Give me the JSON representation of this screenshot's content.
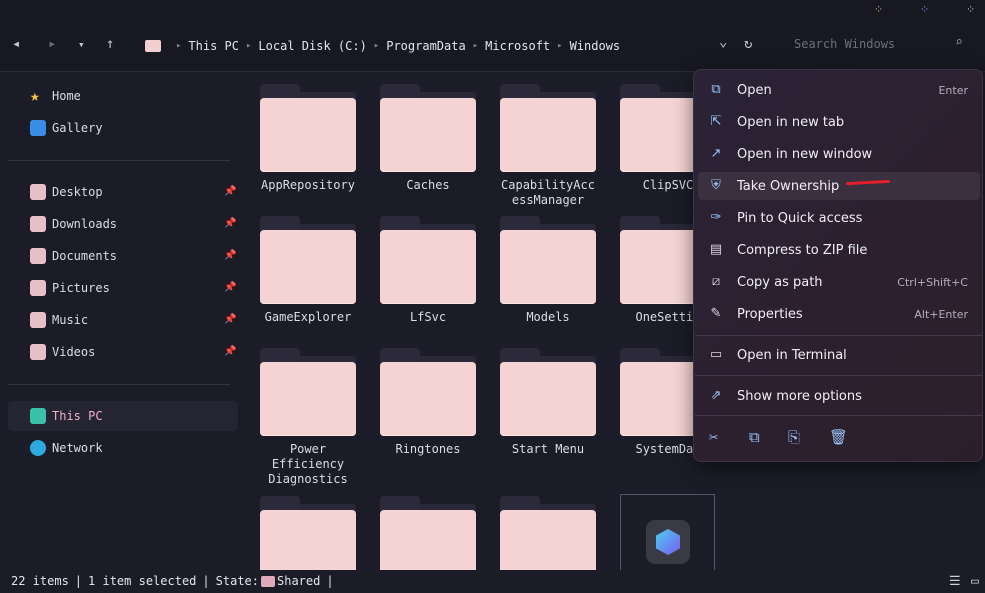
{
  "nav": {
    "back_icon": "◂",
    "forward_icon": "▸",
    "history_icon": "▾",
    "up_icon": "↑",
    "refresh_icon": "↻",
    "dropdown_icon": "⌄",
    "breadcrumb": [
      "This PC",
      "Local Disk (C:)",
      "ProgramData",
      "Microsoft",
      "Windows"
    ],
    "search_placeholder": "Search Windows"
  },
  "sidebar": {
    "quick": [
      {
        "label": "Home",
        "icon": "star-icon",
        "color": "#f5c242"
      },
      {
        "label": "Gallery",
        "icon": "gallery-icon",
        "color": "#3a8ee6"
      }
    ],
    "pinned": [
      {
        "label": "Desktop",
        "icon": "desktop-icon"
      },
      {
        "label": "Downloads",
        "icon": "downloads-icon"
      },
      {
        "label": "Documents",
        "icon": "documents-icon"
      },
      {
        "label": "Pictures",
        "icon": "pictures-icon"
      },
      {
        "label": "Music",
        "icon": "music-icon"
      },
      {
        "label": "Videos",
        "icon": "videos-icon"
      }
    ],
    "devices": [
      {
        "label": "This PC",
        "icon": "pc-icon",
        "color": "#3ac0a8"
      },
      {
        "label": "Network",
        "icon": "network-icon",
        "color": "#2ea8e0"
      }
    ]
  },
  "folders": [
    "AppRepository",
    "Caches",
    "CapabilityAccessManager",
    "ClipSVC",
    "GameExplorer",
    "LfSvc",
    "Models",
    "OneSettin",
    "Power Efficiency Diagnostics",
    "Ringtones",
    "Start Menu",
    "SystemDat",
    "",
    "",
    ""
  ],
  "folder_labels_wrapped": {
    "capability_1": "CapabilityAcc",
    "capability_2": "essManager",
    "power_1": "Power",
    "power_2": "Efficiency",
    "power_3": "Diagnostics"
  },
  "context_menu": {
    "items": [
      {
        "label": "Open",
        "shortcut": "Enter",
        "icon": "open-icon"
      },
      {
        "label": "Open in new tab",
        "shortcut": "",
        "icon": "new-tab-icon"
      },
      {
        "label": "Open in new window",
        "shortcut": "",
        "icon": "new-window-icon"
      },
      {
        "label": "Take Ownership",
        "shortcut": "",
        "icon": "shield-icon"
      },
      {
        "label": "Pin to Quick access",
        "shortcut": "",
        "icon": "pin-icon"
      },
      {
        "label": "Compress to ZIP file",
        "shortcut": "",
        "icon": "zip-icon"
      },
      {
        "label": "Copy as path",
        "shortcut": "Ctrl+Shift+C",
        "icon": "copy-path-icon"
      },
      {
        "label": "Properties",
        "shortcut": "Alt+Enter",
        "icon": "wrench-icon"
      },
      {
        "label": "Open in Terminal",
        "shortcut": "",
        "icon": "terminal-icon"
      },
      {
        "label": "Show more options",
        "shortcut": "",
        "icon": "more-options-icon"
      }
    ],
    "actions": [
      "cut-icon",
      "copy-icon",
      "rename-icon",
      "delete-icon"
    ]
  },
  "status": {
    "items": "22 items",
    "selected": "1 item selected",
    "state_label": "State:",
    "state_value": "Shared"
  },
  "colors": {
    "accent": "#9ac4f8",
    "folder": "#f3d3d3",
    "highlight_mark": "#e0202a"
  }
}
